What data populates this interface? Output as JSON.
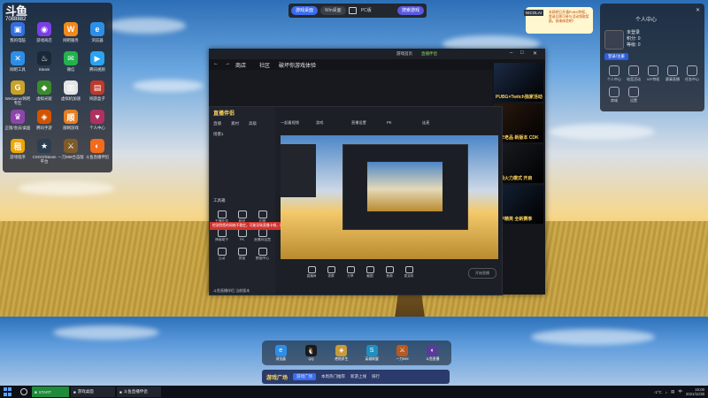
{
  "top_switcher": {
    "left_tab": "游戏桌面",
    "right_tab": "Win桌面",
    "middle": "PC版",
    "search": "搜索游戏"
  },
  "left_panel": {
    "logo": "斗鱼",
    "user_id": "7088882",
    "apps": [
      {
        "label": "我的电脑",
        "icon": "computer-icon",
        "color": "#2f6fe0",
        "glyph": "▣"
      },
      {
        "label": "游戏商店",
        "icon": "game-store-icon",
        "color": "#7b3fe4",
        "glyph": "◉"
      },
      {
        "label": "网吧服务",
        "icon": "netbar-icon",
        "color": "#f08a1c",
        "glyph": "W"
      },
      {
        "label": "浏览器",
        "icon": "browser-icon",
        "color": "#2d8ee8",
        "glyph": "e"
      },
      {
        "label": "网吧工具",
        "icon": "tools-icon",
        "color": "#2d8ee8",
        "glyph": "✕"
      },
      {
        "label": "Steam",
        "icon": "steam-icon",
        "color": "#1b2838",
        "glyph": "♨"
      },
      {
        "label": "微信",
        "icon": "wechat-icon",
        "color": "#22b14c",
        "glyph": "✉"
      },
      {
        "label": "腾讯视频",
        "icon": "video-icon",
        "color": "#2aa3f0",
        "glyph": "▶"
      },
      {
        "label": "WeGame/网吧专区",
        "icon": "wegame-icon",
        "color": "#c9a227",
        "glyph": "G"
      },
      {
        "label": "虚拟光驱",
        "icon": "drive-icon",
        "color": "#3c8c2c",
        "glyph": "◆"
      },
      {
        "label": "虚拟机加速",
        "icon": "accel-icon",
        "color": "#e4e4e4",
        "glyph": "▥"
      },
      {
        "label": "网游盒子",
        "icon": "box-icon",
        "color": "#c0392b",
        "glyph": "▤"
      },
      {
        "label": "正版/会员/桌面",
        "icon": "desk-icon",
        "color": "#8e44ad",
        "glyph": "♛"
      },
      {
        "label": "腾讯手游",
        "icon": "mobile-game-icon",
        "color": "#d35400",
        "glyph": "◈"
      },
      {
        "label": "顺网游戏",
        "icon": "shunwang-icon",
        "color": "#e67e22",
        "glyph": "顺"
      },
      {
        "label": "个人中心",
        "icon": "profile-icon",
        "color": "#b03060",
        "glyph": "♥"
      },
      {
        "label": "游戏程序",
        "icon": "game-exe-icon",
        "color": "#f0a500",
        "glyph": "租"
      },
      {
        "label": "CSGO/Steam平台",
        "icon": "csgo-icon",
        "color": "#2c3e50",
        "glyph": "★"
      },
      {
        "label": "一刀999合击版",
        "icon": "legend-icon",
        "color": "#7f5a2a",
        "glyph": "⚔"
      },
      {
        "label": "斗鱼直播伴侣",
        "icon": "douyu-companion-icon",
        "color": "#f26a1b",
        "glyph": "◐"
      }
    ]
  },
  "notify": {
    "tag": "NICOLAI",
    "text": "本网吧已开通PUBG特权，登录后即可参与活动领取奖励，快来体验吧！"
  },
  "right_panel": {
    "title": "个人中心",
    "close": "✕",
    "user": {
      "name": "未登录",
      "line1": "积分: 0",
      "line2": "等级: 0"
    },
    "login_btn": "登录/注册",
    "items": [
      {
        "label": "个人中心",
        "icon": "user-icon"
      },
      {
        "label": "电竞活动",
        "icon": "esports-icon"
      },
      {
        "label": "VIP特权",
        "icon": "vip-icon"
      },
      {
        "label": "赛事直播",
        "icon": "live-icon"
      },
      {
        "label": "任务中心",
        "icon": "task-icon"
      },
      {
        "label": "商城",
        "icon": "shop-icon"
      },
      {
        "label": "设置",
        "icon": "settings-icon"
      }
    ]
  },
  "main_window": {
    "tabs": [
      "游戏首页",
      "直播伴侣"
    ],
    "nav": {
      "back": "←",
      "forward": "→",
      "store": "商店",
      "community": "社区",
      "tagline": "破坏你游戏体验"
    },
    "ads": [
      {
        "text": "PUBG×Twitch独家活动",
        "color": "#1b2a44"
      },
      {
        "text": "十年老品 新版本 CDK",
        "color": "#2b1a10"
      },
      {
        "text": "无限火力模式 开启",
        "color": "#1a1d22"
      },
      {
        "text": "和平精英 全新赛季",
        "color": "#142236"
      }
    ]
  },
  "streaming_tool": {
    "logo": "直播伴侣",
    "side_tabs": [
      "直播",
      "素材",
      "高级"
    ],
    "scene": "场景1",
    "tools_title": "工具箱",
    "tools": [
      {
        "label": "主播任务",
        "icon": "task-icon"
      },
      {
        "label": "粉丝",
        "icon": "fans-icon"
      },
      {
        "label": "礼物",
        "icon": "gift-icon"
      },
      {
        "label": "弹幕助手",
        "icon": "danmu-icon"
      },
      {
        "label": "PK",
        "icon": "pk-icon"
      },
      {
        "label": "直播间设置",
        "icon": "room-settings-icon"
      },
      {
        "label": "互动",
        "icon": "interact-icon"
      },
      {
        "label": "房管",
        "icon": "admin-icon"
      },
      {
        "label": "数据中心",
        "icon": "data-icon"
      }
    ],
    "warning": "检测到您的网络不稳定，可能导致直播卡顿，请检查网络设置",
    "footer": "斗鱼直播伴侣 当前版本",
    "top_labels": [
      "一起看视频",
      "游戏",
      "直播设置",
      "PK",
      "连麦"
    ],
    "bottom_items": [
      {
        "label": "直播间",
        "icon": "room-icon"
      },
      {
        "label": "录屏",
        "icon": "record-icon"
      },
      {
        "label": "分享",
        "icon": "share-icon"
      },
      {
        "label": "截图",
        "icon": "screenshot-icon"
      },
      {
        "label": "音频",
        "icon": "audio-icon"
      },
      {
        "label": "麦克风",
        "icon": "mic-icon"
      }
    ],
    "start_live": "开始直播"
  },
  "dock": {
    "apps": [
      {
        "label": "浏览器",
        "icon": "ie-icon",
        "color": "#2d8ee8",
        "glyph": "e"
      },
      {
        "label": "QQ",
        "icon": "qq-icon",
        "color": "#1a1a1a",
        "glyph": "🐧"
      },
      {
        "label": "绝地求生",
        "icon": "pubg-icon",
        "color": "#c69b3a",
        "glyph": "◈"
      },
      {
        "label": "英雄联盟",
        "icon": "lol-icon",
        "color": "#1e90c0",
        "glyph": "S"
      },
      {
        "label": "一刀999",
        "icon": "legend-icon",
        "color": "#b85a20",
        "glyph": "⚔"
      },
      {
        "label": "斗鱼直播",
        "icon": "douyu-icon",
        "color": "#5a3a9a",
        "glyph": "◐"
      }
    ]
  },
  "broadcast": {
    "logo": "游戏广场",
    "tabs": [
      "游戏广场",
      "本周热门推荐",
      "新游上线",
      "排行"
    ]
  },
  "taskbar": {
    "tasks": [
      {
        "label": "START",
        "style": "green"
      },
      {
        "label": "游戏桌面",
        "style": "plain"
      },
      {
        "label": "斗鱼直播伴侣",
        "style": "plain"
      }
    ],
    "tray": {
      "temp": "-1°C",
      "lang": "中",
      "time": "15:00",
      "date": "2021/11/30"
    }
  }
}
